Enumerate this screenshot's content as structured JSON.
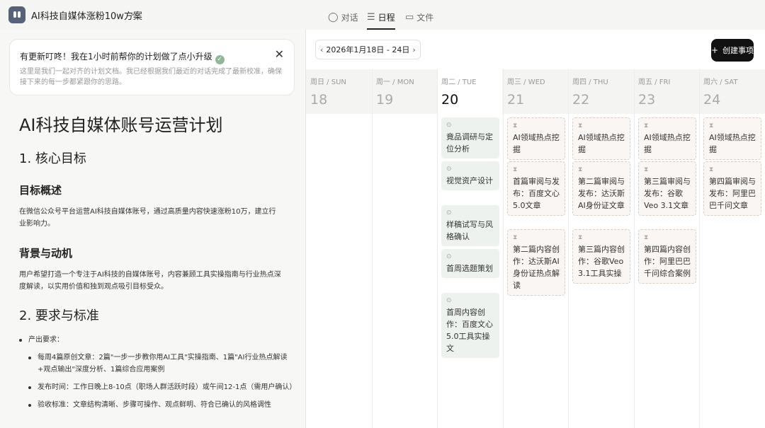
{
  "app": {
    "title": "AI科技自媒体涨粉10w方案"
  },
  "view_tabs": [
    {
      "label": "对话",
      "icon": "chat-bubble-icon"
    },
    {
      "label": "日程",
      "icon": "schedule-list-icon"
    },
    {
      "label": "文件",
      "icon": "folder-icon"
    }
  ],
  "update_notice": {
    "title": "有更新叮咚！我在1小时前帮你的计划做了点小升级",
    "body": "这里是我们一起对齐的计划文档。我已经根据我们最近的对话完成了最新校准，确保接下来的每一步都紧跟你的思路。"
  },
  "doc": {
    "title": "AI科技自媒体账号运营计划",
    "section1": "1. 核心目标",
    "overview_heading": "目标概述",
    "overview_text": "在微信公众号平台运营AI科技自媒体账号，通过高质量内容快速涨粉10万，建立行业影响力。",
    "motivation_heading": "背景与动机",
    "motivation_text": "用户希望打造一个专注于AI科技的自媒体账号，内容兼顾工具实操指南与行业热点深度解读，以实用价值和独到观点吸引目标受众。",
    "section2": "2. 要求与标准",
    "output_req": "产出要求：",
    "req_items": [
      "每周4篇原创文章：2篇\"一步一步教你用AI工具\"实操指南、1篇\"AI行业热点解读+观点输出\"深度分析、1篇综合应用案例",
      "发布时间：工作日晚上8-10点（职场人群活跃时段）或午间12-1点（需用户确认）",
      "验收标准：文章结构清晰、步骤可操作、观点鲜明、符合已确认的风格调性"
    ]
  },
  "calendar": {
    "date_range": "2026年1月18日 - 24日",
    "create_label": "创建事项",
    "days": [
      {
        "weekday": "周日 / SUN",
        "num": "18"
      },
      {
        "weekday": "周一 / MON",
        "num": "19"
      },
      {
        "weekday": "周二 / TUE",
        "num": "20"
      },
      {
        "weekday": "周三 / WED",
        "num": "21"
      },
      {
        "weekday": "周四 / THU",
        "num": "22"
      },
      {
        "weekday": "周五 / FRI",
        "num": "23"
      },
      {
        "weekday": "周六 / SAT",
        "num": "24"
      }
    ],
    "events": {
      "tue": [
        "竟品调研与定位分析",
        "视觉资产设计",
        "样稿试写与风格确认",
        "首周选题策划",
        "首周内容创作：百度文心5.0工具实操文"
      ],
      "wed": [
        "AI领域热点挖掘",
        "首篇审阅与发布：百度文心5.0文章",
        "第二篇内容创作：达沃斯AI身份证热点解读"
      ],
      "thu": [
        "AI领域热点挖掘",
        "第二篇审阅与发布：达沃斯AI身份证文章",
        "第三篇内容创作：谷歌Veo 3.1工具实操"
      ],
      "fri": [
        "AI领域热点挖掘",
        "第三篇审阅与发布：谷歌Veo 3.1文章",
        "第四篇内容创作：阿里巴巴千问综合案例"
      ],
      "sat": [
        "AI领域热点挖掘",
        "第四篇审阅与发布：阿里巴巴千问文章"
      ]
    },
    "done_icon": "check-circle-icon",
    "pending_icon": "hourglass-icon"
  }
}
